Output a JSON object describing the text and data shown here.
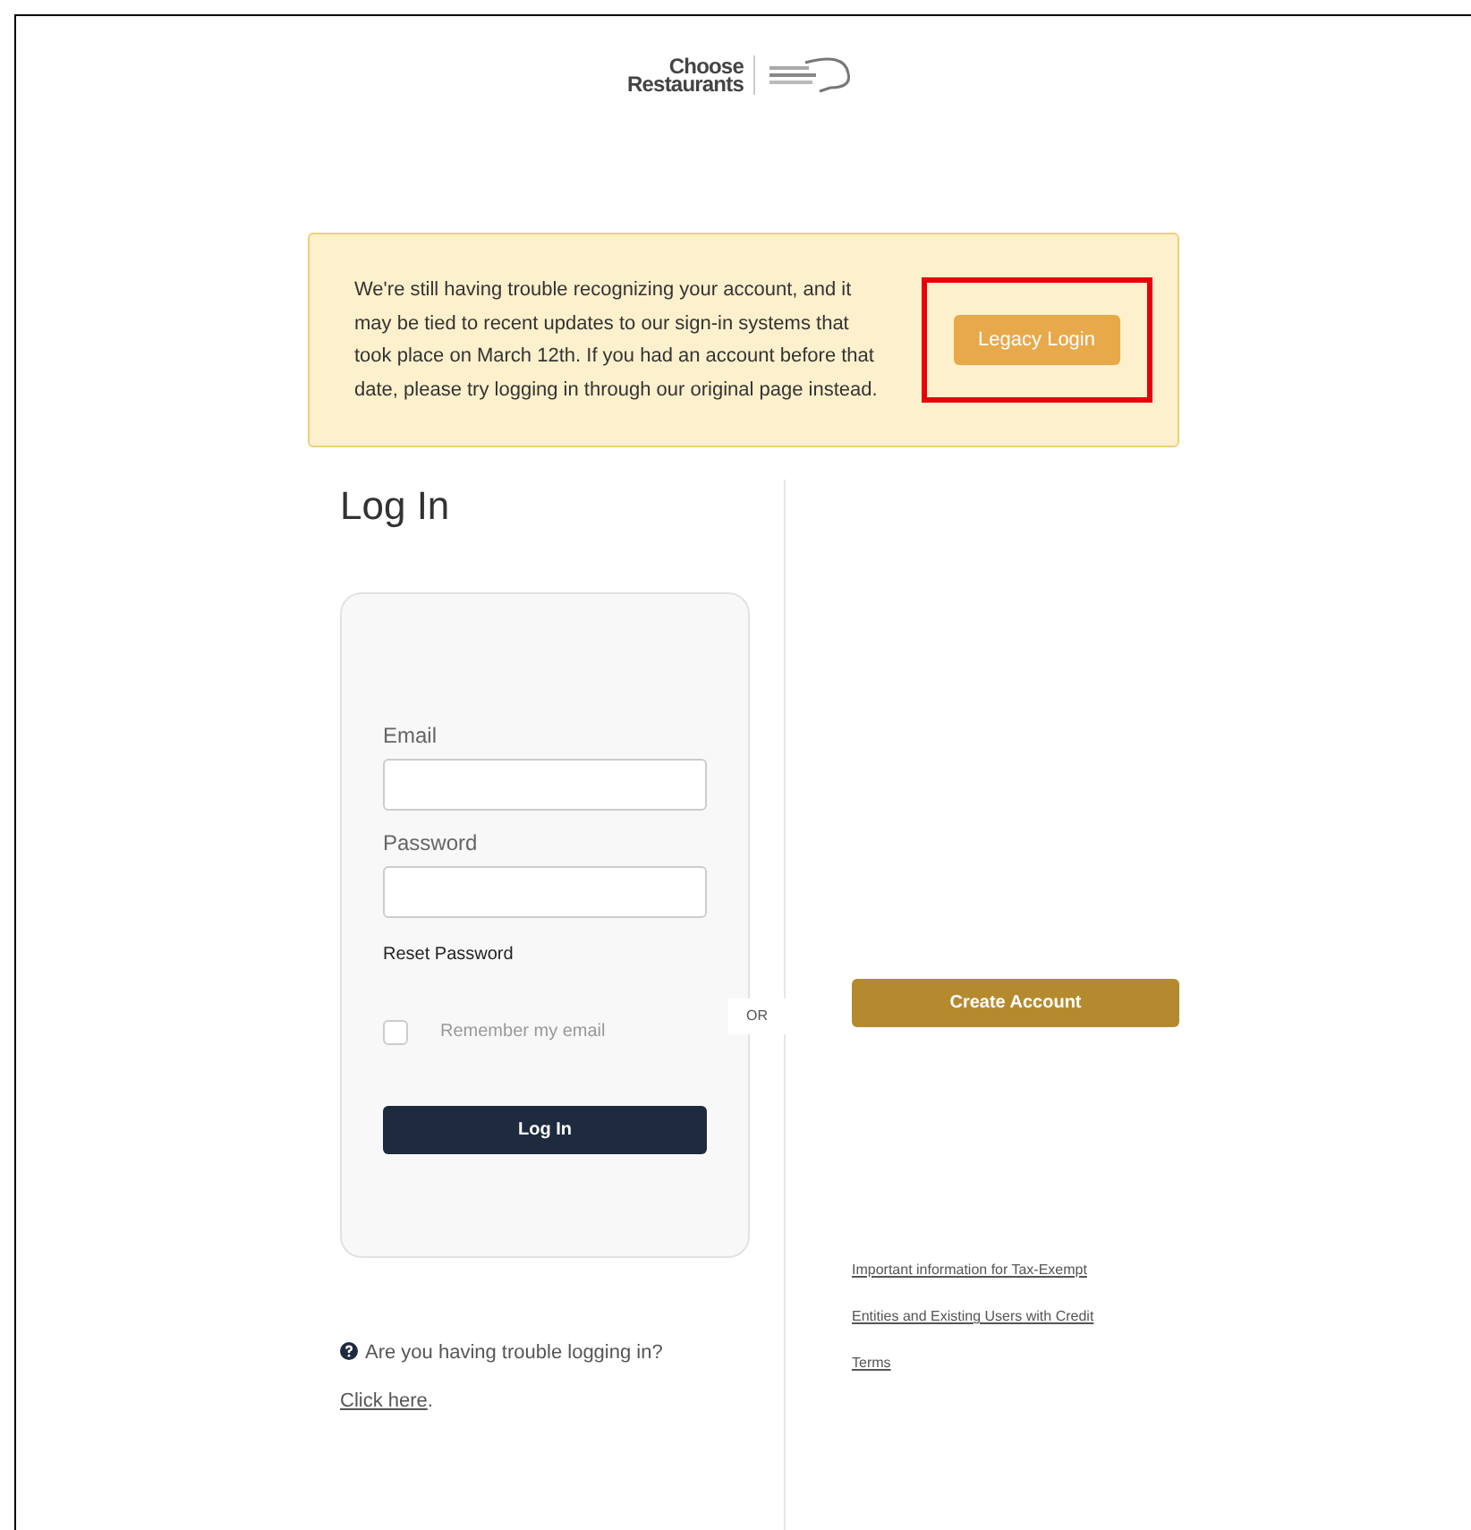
{
  "logo": {
    "line1": "Choose",
    "line2": "Restaurants"
  },
  "notice": {
    "message": "We're still having trouble recognizing your account, and it may be tied to recent updates to our sign-in systems that took place on March 12th. If you had an account before that date, please try logging in through our original page instead.",
    "button": "Legacy Login",
    "highlighted": true
  },
  "login": {
    "title": "Log In",
    "fields": [
      {
        "label": "Email"
      },
      {
        "label": "Password"
      }
    ],
    "reset_link": "Reset Password",
    "remember": {
      "label": "Remember my email",
      "checked": false
    },
    "submit": "Log In"
  },
  "divider_label": "OR",
  "create_account": "Create Account",
  "help": {
    "text": "Are you having trouble logging in?",
    "link": "Click here",
    "end": "."
  },
  "footer_links": [
    "Important information for Tax-Exempt",
    "Entities and Existing Users with Credit",
    "Terms"
  ]
}
